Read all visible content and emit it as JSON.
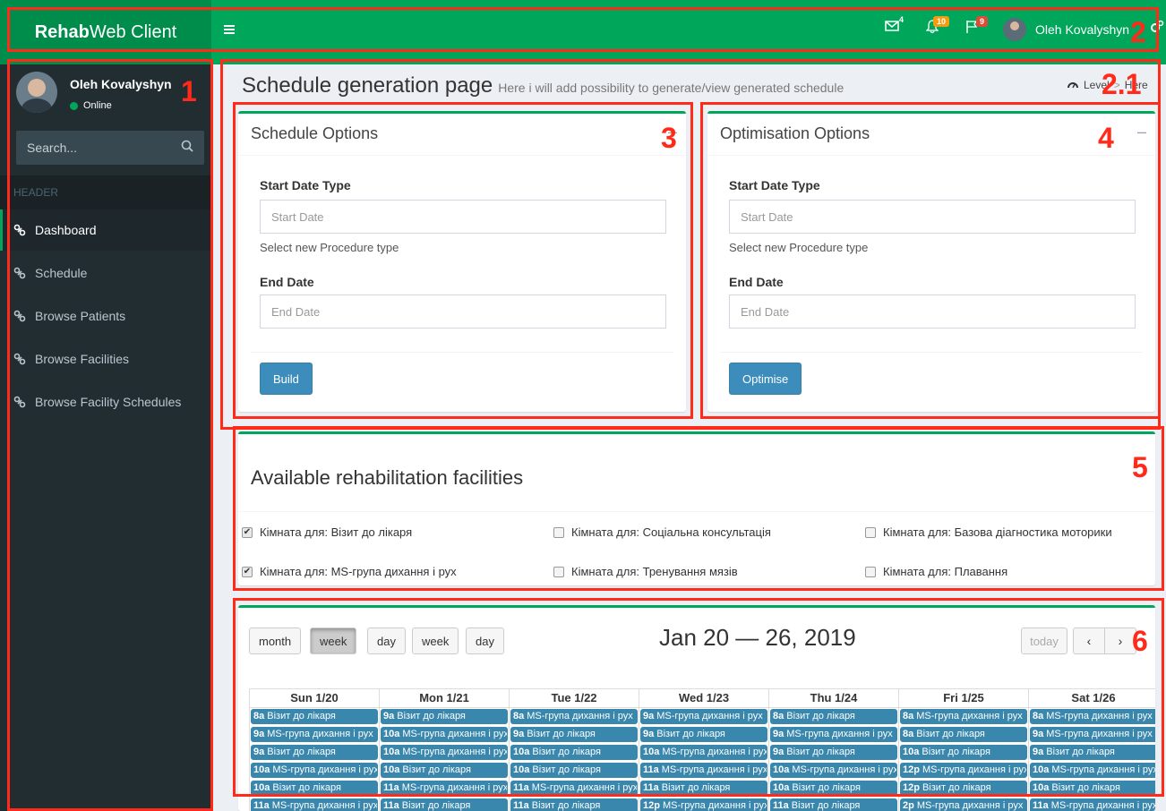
{
  "brand": {
    "bold": "Rehab",
    "rest": "Web Client"
  },
  "topbar": {
    "mail_badge": "4",
    "notif_badge": "10",
    "flag_badge": "9",
    "user_name": "Oleh Kovalyshyn",
    "colors": {
      "bar": "#00a65a",
      "logo": "#008d4c",
      "notif_badge": "#f39c12",
      "flag_badge": "#dd4b39"
    }
  },
  "sidebar": {
    "user_name": "Oleh Kovalyshyn",
    "status": "Online",
    "search_placeholder": "Search...",
    "header": "HEADER",
    "items": [
      {
        "label": "Dashboard",
        "active": true
      },
      {
        "label": "Schedule"
      },
      {
        "label": "Browse Patients"
      },
      {
        "label": "Browse Facilities"
      },
      {
        "label": "Browse Facility Schedules"
      }
    ]
  },
  "page": {
    "title": "Schedule generation page",
    "subtitle": "Here i will add possibility to generate/view generated schedule",
    "breadcrumb": [
      "Level",
      "Here"
    ]
  },
  "schedule_options": {
    "title": "Schedule Options",
    "collapse": "–",
    "start_label": "Start Date Type",
    "start_placeholder": "Start Date",
    "help": "Select new Procedure type",
    "end_label": "End Date",
    "end_placeholder": "End Date",
    "button": "Build"
  },
  "optimisation_options": {
    "title": "Optimisation Options",
    "collapse": "–",
    "start_label": "Start Date Type",
    "start_placeholder": "Start Date",
    "help": "Select new Procedure type",
    "end_label": "End Date",
    "end_placeholder": "End Date",
    "button": "Optimise"
  },
  "facilities": {
    "title": "Available rehabilitation facilities",
    "items": [
      {
        "label": "Кімната для: Візит до лікаря",
        "checked": true
      },
      {
        "label": "Кімната для: Соціальна консультація",
        "checked": false
      },
      {
        "label": "Кімната для: Базова діагностика моторики",
        "checked": false
      },
      {
        "label": "Кімната для: MS-група дихання і рух",
        "checked": true
      },
      {
        "label": "Кімната для: Тренування мязів",
        "checked": false
      },
      {
        "label": "Кімната для: Плавання",
        "checked": false
      }
    ]
  },
  "calendar": {
    "view_buttons": [
      "month",
      "week",
      "day",
      "week",
      "day"
    ],
    "active_view": 1,
    "title": "Jan 20 — 26, 2019",
    "today": "today",
    "prev": "‹",
    "next": "›",
    "days": [
      "Sun 1/20",
      "Mon 1/21",
      "Tue 1/22",
      "Wed 1/23",
      "Thu 1/24",
      "Fri 1/25",
      "Sat 1/26"
    ],
    "events": [
      [
        {
          "t": "8a",
          "n": "Візит до лікаря"
        },
        {
          "t": "9a",
          "n": "MS-група дихання і рух"
        },
        {
          "t": "9a",
          "n": "Візит до лікаря"
        },
        {
          "t": "10a",
          "n": "MS-група дихання і рух"
        },
        {
          "t": "10a",
          "n": "Візит до лікаря"
        },
        {
          "t": "11a",
          "n": "MS-група дихання і рух"
        }
      ],
      [
        {
          "t": "9a",
          "n": "Візит до лікаря"
        },
        {
          "t": "10a",
          "n": "MS-група дихання і рух"
        },
        {
          "t": "10a",
          "n": "MS-група дихання і рух"
        },
        {
          "t": "10a",
          "n": "Візит до лікаря"
        },
        {
          "t": "11a",
          "n": "MS-група дихання і рух"
        },
        {
          "t": "11a",
          "n": "Візит до лікаря"
        }
      ],
      [
        {
          "t": "8a",
          "n": "MS-група дихання і рух"
        },
        {
          "t": "9a",
          "n": "Візит до лікаря"
        },
        {
          "t": "10a",
          "n": "Візит до лікаря"
        },
        {
          "t": "10a",
          "n": "Візит до лікаря"
        },
        {
          "t": "11a",
          "n": "MS-група дихання і рух"
        },
        {
          "t": "11a",
          "n": "Візит до лікаря"
        }
      ],
      [
        {
          "t": "9a",
          "n": "MS-група дихання і рух"
        },
        {
          "t": "9a",
          "n": "Візит до лікаря"
        },
        {
          "t": "10a",
          "n": "MS-група дихання і рух"
        },
        {
          "t": "11a",
          "n": "MS-група дихання і рух"
        },
        {
          "t": "11a",
          "n": "Візит до лікаря"
        },
        {
          "t": "12p",
          "n": "MS-група дихання і рух"
        }
      ],
      [
        {
          "t": "8a",
          "n": "Візит до лікаря"
        },
        {
          "t": "9a",
          "n": "MS-група дихання і рух"
        },
        {
          "t": "9a",
          "n": "Візит до лікаря"
        },
        {
          "t": "10a",
          "n": "MS-група дихання і рух"
        },
        {
          "t": "10a",
          "n": "Візит до лікаря"
        },
        {
          "t": "11a",
          "n": "Візит до лікаря"
        }
      ],
      [
        {
          "t": "8a",
          "n": "MS-група дихання і рух"
        },
        {
          "t": "8a",
          "n": "Візит до лікаря"
        },
        {
          "t": "10a",
          "n": "Візит до лікаря"
        },
        {
          "t": "12p",
          "n": "MS-група дихання і рух"
        },
        {
          "t": "12p",
          "n": "Візит до лікаря"
        },
        {
          "t": "2p",
          "n": "MS-група дихання і рух"
        }
      ],
      [
        {
          "t": "8a",
          "n": "MS-група дихання і рух"
        },
        {
          "t": "9a",
          "n": "MS-група дихання і рух"
        },
        {
          "t": "9a",
          "n": "Візит до лікаря"
        },
        {
          "t": "10a",
          "n": "MS-група дихання і рух"
        },
        {
          "t": "10a",
          "n": "Візит до лікаря"
        },
        {
          "t": "11a",
          "n": "MS-група дихання і рух"
        }
      ]
    ],
    "event_color": "#3a87ad"
  },
  "annotations": {
    "color": "#ff2a1a",
    "labels": [
      "1",
      "2",
      "2.1",
      "3",
      "4",
      "5",
      "6"
    ]
  }
}
